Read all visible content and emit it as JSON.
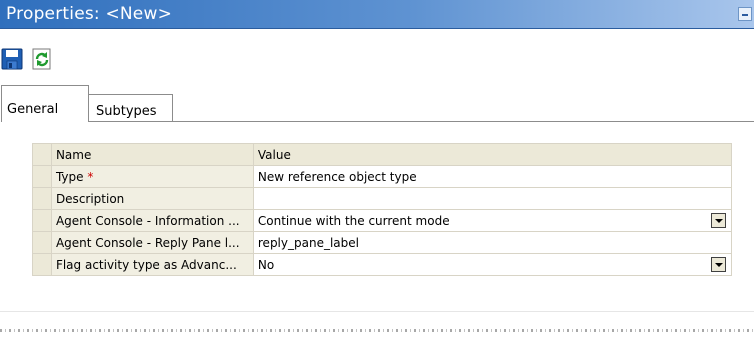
{
  "window": {
    "title": "Properties: <New>"
  },
  "toolbar": {
    "save_icon": "save-disk-icon",
    "refresh_icon": "refresh-icon"
  },
  "tabs": [
    {
      "label": "General",
      "active": true
    },
    {
      "label": "Subtypes",
      "active": false
    }
  ],
  "grid": {
    "header": {
      "name": "Name",
      "value": "Value"
    },
    "rows": [
      {
        "name": "Type",
        "required_mark": "*",
        "value": "New reference object type",
        "dropdown": false
      },
      {
        "name": "Description",
        "value": "",
        "dropdown": false
      },
      {
        "name": "Agent Console - Information ...",
        "value": "Continue with the current mode",
        "dropdown": true
      },
      {
        "name": "Agent Console - Reply Pane l...",
        "value": "reply_pane_label",
        "dropdown": false
      },
      {
        "name": "Flag activity type as Advanc...",
        "value": "No",
        "dropdown": true
      }
    ]
  },
  "colors": {
    "title_bar": "#2f6fbd",
    "grid_header": "#ece9d8",
    "required": "#cc0000"
  }
}
